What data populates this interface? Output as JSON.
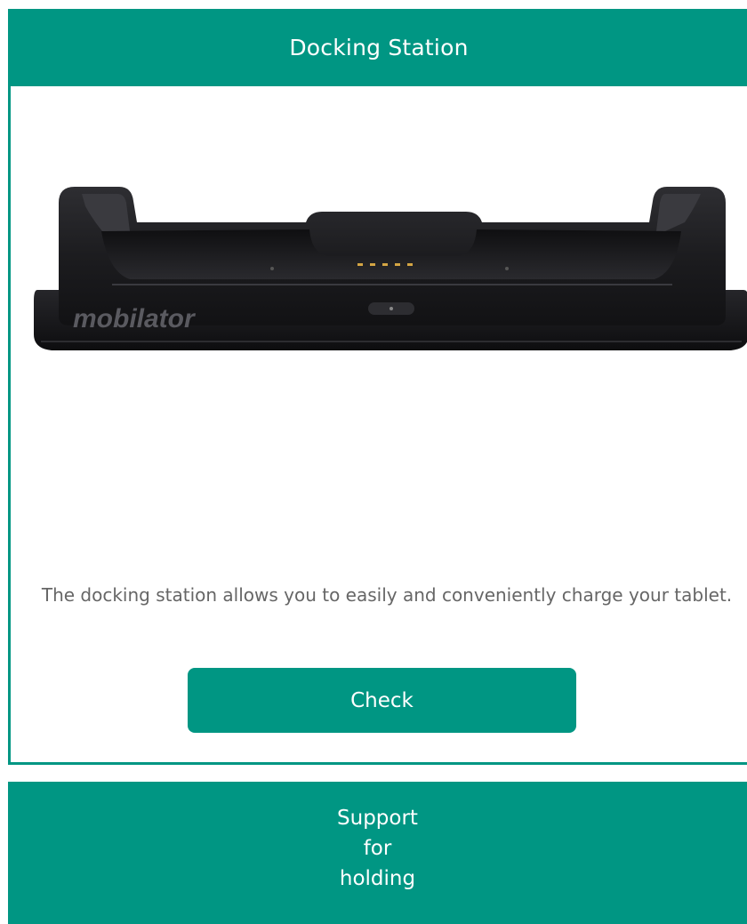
{
  "docking_card": {
    "title": "Docking Station",
    "product_image": {
      "alt": "Docking station product photo",
      "brand_mark": "mobilator",
      "colors": {
        "body": "#1f1f22",
        "base": "#141416",
        "highlight": "#3a3a3f",
        "pins": "#d4a544"
      }
    },
    "description": "The docking station allows you to easily and conveniently charge your tablet.",
    "check_label": "Check"
  },
  "support_card": {
    "title_lines": [
      "Support",
      "for",
      "holding"
    ]
  },
  "colors": {
    "accent": "#009683",
    "text_muted": "#666666",
    "background": "#ffffff"
  }
}
